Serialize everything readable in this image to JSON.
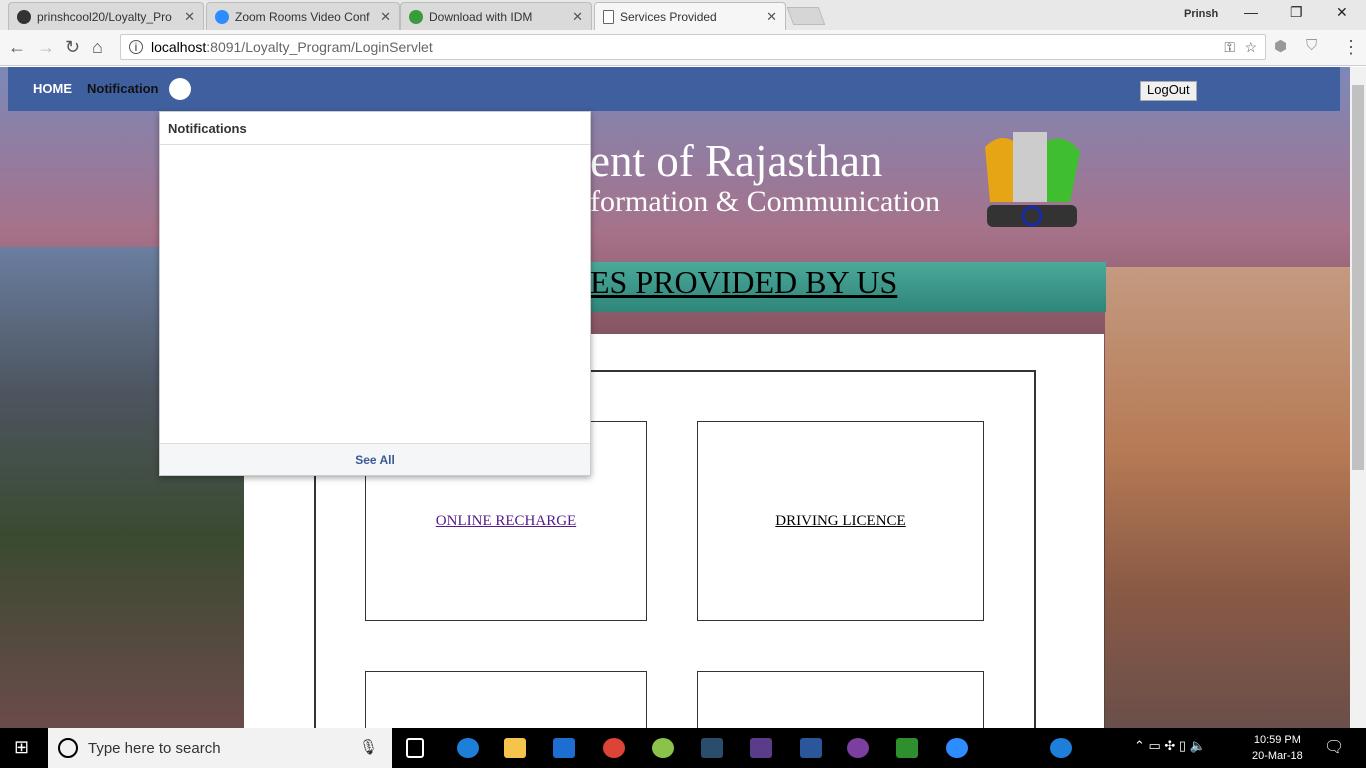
{
  "browser": {
    "tabs": [
      {
        "title": "prinshcool20/Loyalty_Pro",
        "icon": "github-icon",
        "color": "#333333"
      },
      {
        "title": "Zoom Rooms Video Conf",
        "icon": "zoom-icon",
        "color": "#2d8cff"
      },
      {
        "title": "Download with IDM",
        "icon": "idm-icon",
        "color": "#3a9b3a"
      },
      {
        "title": "Services Provided",
        "icon": "page-icon",
        "color": "#ffffff"
      }
    ],
    "close_glyph": "✕",
    "user": "Prinsh",
    "url_host": "localhost",
    "url_rest": ":8091/Loyalty_Program/LoginServlet"
  },
  "navbar": {
    "home": "HOME",
    "notification": "Notification",
    "logout": "LogOut"
  },
  "header": {
    "title_fragment": "ent of Rajasthan",
    "subtitle_fragment": "formation & Communication",
    "banner_fragment": "ES PROVIDED BY US"
  },
  "services": [
    "ONLINE RECHARGE",
    "DRIVING LICENCE"
  ],
  "notifications": {
    "title": "Notifications",
    "see_all": "See All"
  },
  "taskbar": {
    "search_placeholder": "Type here to search",
    "time": "10:59 PM",
    "date": "20-Mar-18"
  }
}
